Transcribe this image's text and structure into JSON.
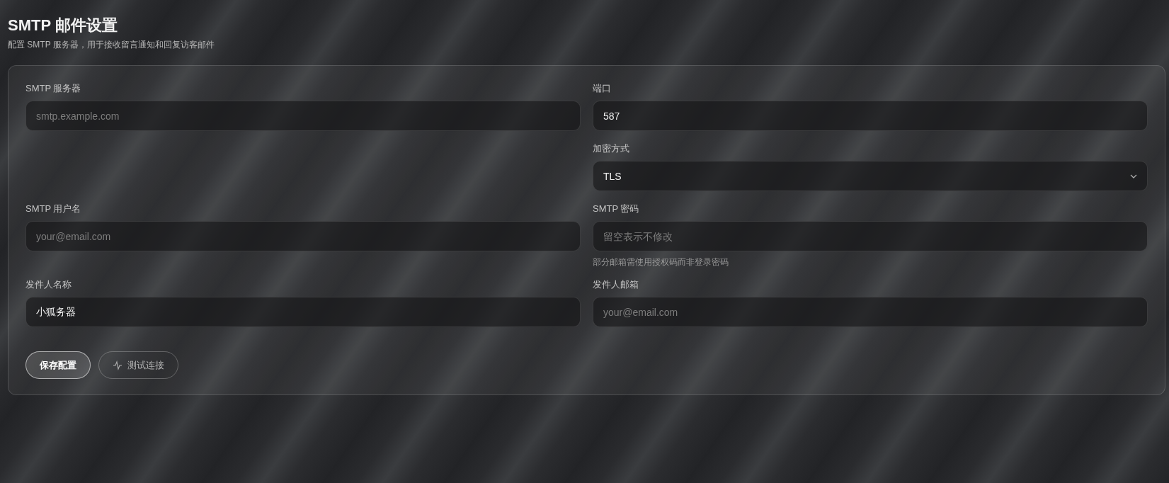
{
  "header": {
    "title": "SMTP 邮件设置",
    "subtitle": "配置 SMTP 服务器，用于接收留言通知和回复访客邮件"
  },
  "rows": [
    {
      "left": {
        "kind": "input",
        "label": "SMTP 服务器",
        "placeholder": "smtp.example.com"
      },
      "right": {
        "kind": "input",
        "label": "端口",
        "value": "587"
      }
    },
    {
      "right": {
        "kind": "select",
        "label": "加密方式",
        "value": "TLS"
      }
    },
    {
      "left": {
        "kind": "input",
        "label": "SMTP 用户名",
        "placeholder": "your@email.com"
      },
      "right": {
        "kind": "input",
        "label": "SMTP 密码",
        "placeholder": "留空表示不修改",
        "hint": "部分邮箱需使用授权码而非登录密码"
      }
    },
    {
      "left": {
        "kind": "input",
        "label": "发件人名称",
        "value": "小狐务器"
      },
      "right": {
        "kind": "input",
        "label": "发件人邮箱",
        "placeholder": "your@email.com"
      }
    }
  ],
  "buttons": [
    {
      "kind": "primary",
      "label": "保存配置"
    },
    {
      "kind": "outline",
      "label": "测试连接"
    }
  ]
}
